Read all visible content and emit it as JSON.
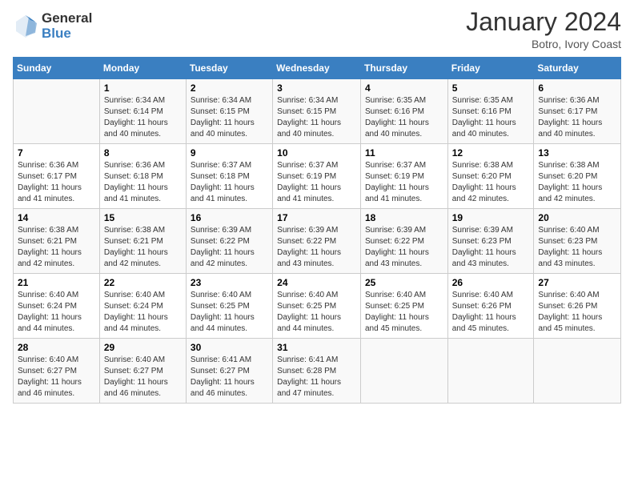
{
  "logo": {
    "general": "General",
    "blue": "Blue"
  },
  "title": "January 2024",
  "subtitle": "Botro, Ivory Coast",
  "days_header": [
    "Sunday",
    "Monday",
    "Tuesday",
    "Wednesday",
    "Thursday",
    "Friday",
    "Saturday"
  ],
  "weeks": [
    [
      {
        "day": "",
        "info": ""
      },
      {
        "day": "1",
        "info": "Sunrise: 6:34 AM\nSunset: 6:14 PM\nDaylight: 11 hours and 40 minutes."
      },
      {
        "day": "2",
        "info": "Sunrise: 6:34 AM\nSunset: 6:15 PM\nDaylight: 11 hours and 40 minutes."
      },
      {
        "day": "3",
        "info": "Sunrise: 6:34 AM\nSunset: 6:15 PM\nDaylight: 11 hours and 40 minutes."
      },
      {
        "day": "4",
        "info": "Sunrise: 6:35 AM\nSunset: 6:16 PM\nDaylight: 11 hours and 40 minutes."
      },
      {
        "day": "5",
        "info": "Sunrise: 6:35 AM\nSunset: 6:16 PM\nDaylight: 11 hours and 40 minutes."
      },
      {
        "day": "6",
        "info": "Sunrise: 6:36 AM\nSunset: 6:17 PM\nDaylight: 11 hours and 40 minutes."
      }
    ],
    [
      {
        "day": "7",
        "info": "Sunrise: 6:36 AM\nSunset: 6:17 PM\nDaylight: 11 hours and 41 minutes."
      },
      {
        "day": "8",
        "info": "Sunrise: 6:36 AM\nSunset: 6:18 PM\nDaylight: 11 hours and 41 minutes."
      },
      {
        "day": "9",
        "info": "Sunrise: 6:37 AM\nSunset: 6:18 PM\nDaylight: 11 hours and 41 minutes."
      },
      {
        "day": "10",
        "info": "Sunrise: 6:37 AM\nSunset: 6:19 PM\nDaylight: 11 hours and 41 minutes."
      },
      {
        "day": "11",
        "info": "Sunrise: 6:37 AM\nSunset: 6:19 PM\nDaylight: 11 hours and 41 minutes."
      },
      {
        "day": "12",
        "info": "Sunrise: 6:38 AM\nSunset: 6:20 PM\nDaylight: 11 hours and 42 minutes."
      },
      {
        "day": "13",
        "info": "Sunrise: 6:38 AM\nSunset: 6:20 PM\nDaylight: 11 hours and 42 minutes."
      }
    ],
    [
      {
        "day": "14",
        "info": "Sunrise: 6:38 AM\nSunset: 6:21 PM\nDaylight: 11 hours and 42 minutes."
      },
      {
        "day": "15",
        "info": "Sunrise: 6:38 AM\nSunset: 6:21 PM\nDaylight: 11 hours and 42 minutes."
      },
      {
        "day": "16",
        "info": "Sunrise: 6:39 AM\nSunset: 6:22 PM\nDaylight: 11 hours and 42 minutes."
      },
      {
        "day": "17",
        "info": "Sunrise: 6:39 AM\nSunset: 6:22 PM\nDaylight: 11 hours and 43 minutes."
      },
      {
        "day": "18",
        "info": "Sunrise: 6:39 AM\nSunset: 6:22 PM\nDaylight: 11 hours and 43 minutes."
      },
      {
        "day": "19",
        "info": "Sunrise: 6:39 AM\nSunset: 6:23 PM\nDaylight: 11 hours and 43 minutes."
      },
      {
        "day": "20",
        "info": "Sunrise: 6:40 AM\nSunset: 6:23 PM\nDaylight: 11 hours and 43 minutes."
      }
    ],
    [
      {
        "day": "21",
        "info": "Sunrise: 6:40 AM\nSunset: 6:24 PM\nDaylight: 11 hours and 44 minutes."
      },
      {
        "day": "22",
        "info": "Sunrise: 6:40 AM\nSunset: 6:24 PM\nDaylight: 11 hours and 44 minutes."
      },
      {
        "day": "23",
        "info": "Sunrise: 6:40 AM\nSunset: 6:25 PM\nDaylight: 11 hours and 44 minutes."
      },
      {
        "day": "24",
        "info": "Sunrise: 6:40 AM\nSunset: 6:25 PM\nDaylight: 11 hours and 44 minutes."
      },
      {
        "day": "25",
        "info": "Sunrise: 6:40 AM\nSunset: 6:25 PM\nDaylight: 11 hours and 45 minutes."
      },
      {
        "day": "26",
        "info": "Sunrise: 6:40 AM\nSunset: 6:26 PM\nDaylight: 11 hours and 45 minutes."
      },
      {
        "day": "27",
        "info": "Sunrise: 6:40 AM\nSunset: 6:26 PM\nDaylight: 11 hours and 45 minutes."
      }
    ],
    [
      {
        "day": "28",
        "info": "Sunrise: 6:40 AM\nSunset: 6:27 PM\nDaylight: 11 hours and 46 minutes."
      },
      {
        "day": "29",
        "info": "Sunrise: 6:40 AM\nSunset: 6:27 PM\nDaylight: 11 hours and 46 minutes."
      },
      {
        "day": "30",
        "info": "Sunrise: 6:41 AM\nSunset: 6:27 PM\nDaylight: 11 hours and 46 minutes."
      },
      {
        "day": "31",
        "info": "Sunrise: 6:41 AM\nSunset: 6:28 PM\nDaylight: 11 hours and 47 minutes."
      },
      {
        "day": "",
        "info": ""
      },
      {
        "day": "",
        "info": ""
      },
      {
        "day": "",
        "info": ""
      }
    ]
  ]
}
